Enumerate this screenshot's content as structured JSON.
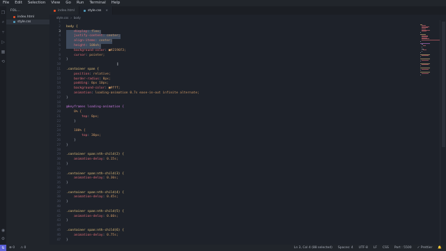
{
  "menu": [
    "File",
    "Edit",
    "Selection",
    "View",
    "Go",
    "Run",
    "Terminal",
    "Help"
  ],
  "sidebar": {
    "header": "FOL...",
    "files": [
      {
        "name": "index.html",
        "color": "#e44d26",
        "selected": false
      },
      {
        "name": "style.css",
        "color": "#519aba",
        "selected": true
      }
    ]
  },
  "tabs": [
    {
      "label": "index.html",
      "color": "#e44d26",
      "active": false
    },
    {
      "label": "style.css",
      "color": "#519aba",
      "active": true,
      "close": "×"
    }
  ],
  "breadcrumb": [
    "style.css",
    "body"
  ],
  "editor": {
    "lines": [
      {
        "n": "1",
        "code": "",
        "t": "plain"
      },
      {
        "n": "2",
        "code": "body {",
        "t": "sel"
      },
      {
        "n": "3",
        "code": "    display: flex;",
        "t": "prop",
        "sel": true,
        "cur": true
      },
      {
        "n": "4",
        "code": "    justify-content: center;",
        "t": "prop",
        "sel": true
      },
      {
        "n": "5",
        "code": "    align-items: center;",
        "t": "prop",
        "sel": true
      },
      {
        "n": "6",
        "code": "    height: 100vh;",
        "t": "prop",
        "sel": true
      },
      {
        "n": "7",
        "code": "    background-color: ■#2196F3;",
        "t": "prop"
      },
      {
        "n": "8",
        "code": "    cursor: pointer;",
        "t": "prop"
      },
      {
        "n": "9",
        "code": "}",
        "t": "brace"
      },
      {
        "n": "10",
        "code": "",
        "t": "plain"
      },
      {
        "n": "11",
        "code": ".container span {",
        "t": "sel"
      },
      {
        "n": "12",
        "code": "    position: relative;",
        "t": "prop"
      },
      {
        "n": "13",
        "code": "    border-radius: 8px;",
        "t": "prop"
      },
      {
        "n": "14",
        "code": "    padding: 0px 10px;",
        "t": "prop"
      },
      {
        "n": "15",
        "code": "    background-color: ■#fff;",
        "t": "prop"
      },
      {
        "n": "16",
        "code": "    animation: loading-animation 0.7s ease-in-out infinite alternate;",
        "t": "prop"
      },
      {
        "n": "17",
        "code": "}",
        "t": "brace"
      },
      {
        "n": "18",
        "code": "",
        "t": "plain"
      },
      {
        "n": "19",
        "code": "@keyframes loading-animation {",
        "t": "at"
      },
      {
        "n": "20",
        "code": "    0% {",
        "t": "kf"
      },
      {
        "n": "21",
        "code": "        top: 0px;",
        "t": "prop"
      },
      {
        "n": "22",
        "code": "    }",
        "t": "brace"
      },
      {
        "n": "23",
        "code": "",
        "t": "plain"
      },
      {
        "n": "24",
        "code": "    100% {",
        "t": "kf"
      },
      {
        "n": "25",
        "code": "        top: 30px;",
        "t": "prop"
      },
      {
        "n": "26",
        "code": "    }",
        "t": "brace"
      },
      {
        "n": "27",
        "code": "}",
        "t": "brace"
      },
      {
        "n": "28",
        "code": "",
        "t": "plain"
      },
      {
        "n": "29",
        "code": ".container span:nth-child(2) {",
        "t": "sel"
      },
      {
        "n": "30",
        "code": "    animation-delay: 0.15s;",
        "t": "prop"
      },
      {
        "n": "31",
        "code": "}",
        "t": "brace"
      },
      {
        "n": "32",
        "code": "",
        "t": "plain"
      },
      {
        "n": "33",
        "code": ".container span:nth-child(3) {",
        "t": "sel"
      },
      {
        "n": "34",
        "code": "    animation-delay: 0.30s;",
        "t": "prop"
      },
      {
        "n": "35",
        "code": "}",
        "t": "brace"
      },
      {
        "n": "36",
        "code": "",
        "t": "plain"
      },
      {
        "n": "37",
        "code": ".container span:nth-child(4) {",
        "t": "sel"
      },
      {
        "n": "38",
        "code": "    animation-delay: 0.45s;",
        "t": "prop"
      },
      {
        "n": "39",
        "code": "}",
        "t": "brace"
      },
      {
        "n": "40",
        "code": "",
        "t": "plain"
      },
      {
        "n": "41",
        "code": ".container span:nth-child(5) {",
        "t": "sel"
      },
      {
        "n": "42",
        "code": "    animation-delay: 0.60s;",
        "t": "prop"
      },
      {
        "n": "43",
        "code": "}",
        "t": "brace"
      },
      {
        "n": "44",
        "code": "",
        "t": "plain"
      },
      {
        "n": "45",
        "code": ".container span:nth-child(6) {",
        "t": "sel"
      },
      {
        "n": "46",
        "code": "    animation-delay: 0.75s;",
        "t": "prop"
      },
      {
        "n": "47",
        "code": "}",
        "t": "brace"
      }
    ]
  },
  "status": {
    "errors": "⊗ 0",
    "warnings": "⚠ 0",
    "position": "Ln 3, Col 4 (88 selected)",
    "spaces": "Spaces: 4",
    "encoding": "UTF-8",
    "eol": "LF",
    "language": "CSS",
    "port": "Port : 5500",
    "prettier": "✓ Prettier"
  },
  "colors": {
    "background": "#1e222a",
    "selector": "#e5c07b",
    "property": "#e06c75",
    "value": "#d19a66",
    "at_rule": "#c678dd",
    "brace": "#abb2bf",
    "selection": "#3e4a5c"
  },
  "icons": [
    "explorer-icon",
    "search-icon",
    "source-control-icon",
    "run-debug-icon",
    "extensions-icon",
    "live-share-icon",
    "account-icon",
    "settings-icon"
  ]
}
